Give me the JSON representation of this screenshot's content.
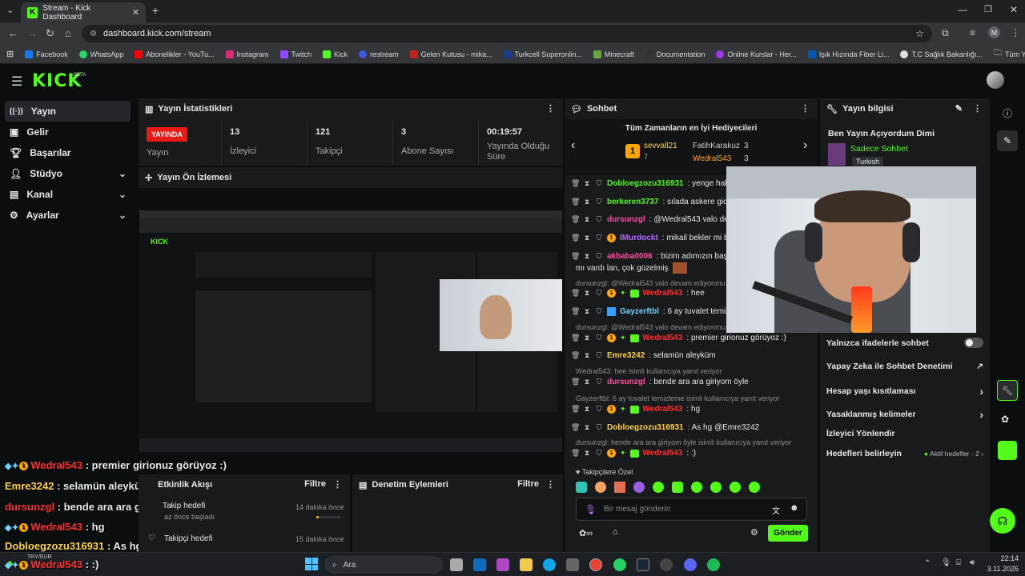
{
  "browser": {
    "tab_title": "Stream - Kick Dashboard",
    "url": "dashboard.kick.com/stream",
    "profile_initial": "M",
    "bookmarks": [
      "Facebook",
      "WhatsApp",
      "Abonelikler - YouTu...",
      "Instagram",
      "Twitch",
      "Kick",
      "restream",
      "Gelen Kutusu - mika...",
      "Turkcell Superonlin...",
      "Minecraft",
      "Documentation",
      "Online Kurslar - Her...",
      "Işık Hızında Fiber Li...",
      "T.C Sağlık Bakanlığı..."
    ],
    "all_bookmarks": "Tüm Yer İşaretleri"
  },
  "brand": "KICK",
  "brand_tag": "BETA",
  "sidebar": {
    "items": [
      {
        "label": "Yayın",
        "icon": "broadcast-icon"
      },
      {
        "label": "Gelir",
        "icon": "money-icon"
      },
      {
        "label": "Başarılar",
        "icon": "trophy-icon"
      },
      {
        "label": "Stüdyo",
        "icon": "studio-icon"
      },
      {
        "label": "Kanal",
        "icon": "channel-icon"
      },
      {
        "label": "Ayarlar",
        "icon": "gear-icon"
      }
    ]
  },
  "stats": {
    "header": "Yayın İstatistikleri",
    "live_badge": "YAYINDA",
    "live_label": "Yayın",
    "viewers_value": "13",
    "viewers_label": "İzleyici",
    "followers_value": "121",
    "followers_label": "Takipçi",
    "subs_value": "3",
    "subs_label": "Abone Sayısı",
    "duration_value": "00:19:57",
    "duration_label": "Yayında Olduğu Süre"
  },
  "preview": {
    "header": "Yayın Ön İzlemesi"
  },
  "overlay_chat": [
    {
      "user": "Wedral543",
      "text": " : premier girionuz görüyoz :)",
      "color": "#ff2f2f"
    },
    {
      "user": "Emre3242",
      "text": " : selamün aleyküm",
      "color": "#ffd23e"
    },
    {
      "user": "dursunzgl",
      "text": " : bende ara ara giriyom öyle",
      "color": "#ff2f2f"
    },
    {
      "user": "Wedral543",
      "text": " : hg",
      "color": "#ff2f2f"
    },
    {
      "user": "Dobloegzozu316931",
      "text": " : As hg @Emre3242",
      "color": "#ffd23e"
    },
    {
      "user": "Wedral543",
      "text": " : :)",
      "color": "#ff2f2f"
    }
  ],
  "activity": {
    "header": "Etkinlik Akışı",
    "filter": "Filtre",
    "items": [
      {
        "title": "Takip hedefi",
        "sub": "az önce başladı",
        "time": "14 dakika önce"
      },
      {
        "title": "Takipçi hedefi",
        "sub": "",
        "time": "15 dakika önce"
      }
    ]
  },
  "moderation": {
    "header": "Denetim Eylemleri",
    "filter": "Filtre"
  },
  "chat": {
    "header": "Sohbet",
    "top_gifters_title": "Tüm Zamanların en İyi Hediyecileri",
    "gifter1": {
      "rank": "1",
      "name": "sevvall21",
      "count": "7"
    },
    "gifter2": {
      "name": "FatihKarakuz",
      "count": "3"
    },
    "gifter3": {
      "name": "Wedral543",
      "count": "3"
    },
    "messages": [
      {
        "user": "Dobloegzozu316931",
        "text": ": yenge hakka",
        "color": "#53fc18"
      },
      {
        "user": "berkeren3737",
        "text": ": sılada askere gidiy",
        "color": "#53fc18"
      },
      {
        "user": "dursunzgl",
        "text": ": @Wedral543 valo deva",
        "color": "#ff4fa3"
      },
      {
        "user": "IMurdockt",
        "text": ": mikail bekler mi bile",
        "color": "#b56bff"
      },
      {
        "user": "akbaba0006",
        "text": ": bizim adımızın başın",
        "color": "#ff4fa3"
      },
      {
        "user": "",
        "text": "mı vardı lan, çok güzelmiş",
        "color": "#e8e8e8"
      },
      {
        "user": "Wedral543",
        "text": ": hee",
        "color": "#ff2f2f"
      },
      {
        "user": "Gayzerftbl",
        "text": ": 6 ay tuvalet temizle",
        "color": "#6bd4ff"
      },
      {
        "user": "Wedral543",
        "text": ": premier girionuz görüyoz :)",
        "color": "#ff2f2f"
      },
      {
        "user": "Emre3242",
        "text": ": selamün aleyküm",
        "color": "#ffd23e"
      },
      {
        "user": "dursunzgl",
        "text": ": bende ara ara giriyom öyle",
        "color": "#ff4fa3"
      },
      {
        "user": "Wedral543",
        "text": ": hg",
        "color": "#ff2f2f"
      },
      {
        "user": "Dobloegzozu316931",
        "text": ": As hg @Emre3242",
        "color": "#53fc18"
      },
      {
        "user": "Wedral543",
        "text": ": :)",
        "color": "#ff2f2f"
      }
    ],
    "reply_notes": [
      "dursunzgl: @Wedral543 valo devam ediyonmu",
      "dursunzgl: @Wedral543 valo devam ediyonmu",
      "Wedral543: hee isimli kullanıcıya yanıt veriyor",
      "Gayzerftbl: 6 ay tuvalet temizleme isimli kullanıcıya yanıt veriyor",
      "dursunzgl: bende ara ara giriyom öyle isimli kullanıcıya yanıt veriyor"
    ],
    "followers_only": "Takipçilere Özel",
    "input_placeholder": "Bir mesaj gönderin",
    "send": "Gönder"
  },
  "info": {
    "header": "Yayın bilgisi",
    "title": "Ben Yayın Açıyordum Dimi",
    "category": "Sadece Sohbet",
    "language": "Turkish",
    "settings": [
      {
        "label": "Yalnızca ifadelerle sohbet",
        "right": ""
      },
      {
        "label": "Yapay Zeka ile Sohbet Denetimi",
        "right": "↗"
      },
      {
        "label": "Hesap yaşı kısıtlaması",
        "right": "›"
      },
      {
        "label": "Yasaklanmış kelimeler",
        "right": "›"
      },
      {
        "label": "İzleyici Yönlendir",
        "right": ""
      },
      {
        "label": "Hedefleri belirleyin",
        "right": "Aktif hedefler - 2 ›"
      }
    ]
  },
  "taskbar": {
    "weather": "TRY/EUR",
    "search": "Ara",
    "time": "22:14",
    "date": "3.11.2025"
  }
}
